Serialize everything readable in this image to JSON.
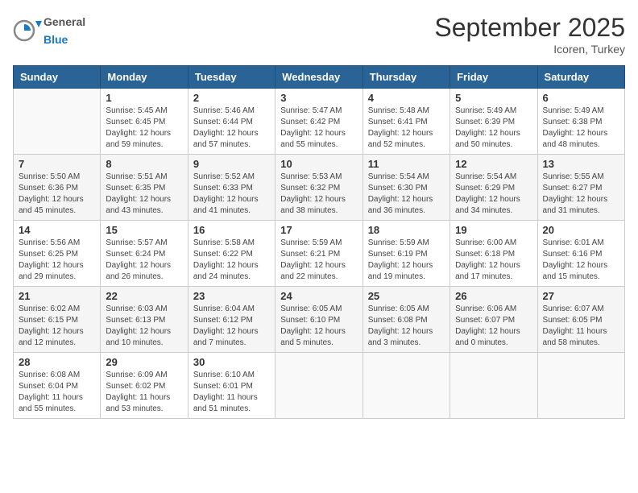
{
  "header": {
    "logo_general": "General",
    "logo_blue": "Blue",
    "month": "September 2025",
    "location": "Icoren, Turkey"
  },
  "days_of_week": [
    "Sunday",
    "Monday",
    "Tuesday",
    "Wednesday",
    "Thursday",
    "Friday",
    "Saturday"
  ],
  "weeks": [
    [
      {
        "day": "",
        "info": ""
      },
      {
        "day": "1",
        "info": "Sunrise: 5:45 AM\nSunset: 6:45 PM\nDaylight: 12 hours\nand 59 minutes."
      },
      {
        "day": "2",
        "info": "Sunrise: 5:46 AM\nSunset: 6:44 PM\nDaylight: 12 hours\nand 57 minutes."
      },
      {
        "day": "3",
        "info": "Sunrise: 5:47 AM\nSunset: 6:42 PM\nDaylight: 12 hours\nand 55 minutes."
      },
      {
        "day": "4",
        "info": "Sunrise: 5:48 AM\nSunset: 6:41 PM\nDaylight: 12 hours\nand 52 minutes."
      },
      {
        "day": "5",
        "info": "Sunrise: 5:49 AM\nSunset: 6:39 PM\nDaylight: 12 hours\nand 50 minutes."
      },
      {
        "day": "6",
        "info": "Sunrise: 5:49 AM\nSunset: 6:38 PM\nDaylight: 12 hours\nand 48 minutes."
      }
    ],
    [
      {
        "day": "7",
        "info": "Sunrise: 5:50 AM\nSunset: 6:36 PM\nDaylight: 12 hours\nand 45 minutes."
      },
      {
        "day": "8",
        "info": "Sunrise: 5:51 AM\nSunset: 6:35 PM\nDaylight: 12 hours\nand 43 minutes."
      },
      {
        "day": "9",
        "info": "Sunrise: 5:52 AM\nSunset: 6:33 PM\nDaylight: 12 hours\nand 41 minutes."
      },
      {
        "day": "10",
        "info": "Sunrise: 5:53 AM\nSunset: 6:32 PM\nDaylight: 12 hours\nand 38 minutes."
      },
      {
        "day": "11",
        "info": "Sunrise: 5:54 AM\nSunset: 6:30 PM\nDaylight: 12 hours\nand 36 minutes."
      },
      {
        "day": "12",
        "info": "Sunrise: 5:54 AM\nSunset: 6:29 PM\nDaylight: 12 hours\nand 34 minutes."
      },
      {
        "day": "13",
        "info": "Sunrise: 5:55 AM\nSunset: 6:27 PM\nDaylight: 12 hours\nand 31 minutes."
      }
    ],
    [
      {
        "day": "14",
        "info": "Sunrise: 5:56 AM\nSunset: 6:25 PM\nDaylight: 12 hours\nand 29 minutes."
      },
      {
        "day": "15",
        "info": "Sunrise: 5:57 AM\nSunset: 6:24 PM\nDaylight: 12 hours\nand 26 minutes."
      },
      {
        "day": "16",
        "info": "Sunrise: 5:58 AM\nSunset: 6:22 PM\nDaylight: 12 hours\nand 24 minutes."
      },
      {
        "day": "17",
        "info": "Sunrise: 5:59 AM\nSunset: 6:21 PM\nDaylight: 12 hours\nand 22 minutes."
      },
      {
        "day": "18",
        "info": "Sunrise: 5:59 AM\nSunset: 6:19 PM\nDaylight: 12 hours\nand 19 minutes."
      },
      {
        "day": "19",
        "info": "Sunrise: 6:00 AM\nSunset: 6:18 PM\nDaylight: 12 hours\nand 17 minutes."
      },
      {
        "day": "20",
        "info": "Sunrise: 6:01 AM\nSunset: 6:16 PM\nDaylight: 12 hours\nand 15 minutes."
      }
    ],
    [
      {
        "day": "21",
        "info": "Sunrise: 6:02 AM\nSunset: 6:15 PM\nDaylight: 12 hours\nand 12 minutes."
      },
      {
        "day": "22",
        "info": "Sunrise: 6:03 AM\nSunset: 6:13 PM\nDaylight: 12 hours\nand 10 minutes."
      },
      {
        "day": "23",
        "info": "Sunrise: 6:04 AM\nSunset: 6:12 PM\nDaylight: 12 hours\nand 7 minutes."
      },
      {
        "day": "24",
        "info": "Sunrise: 6:05 AM\nSunset: 6:10 PM\nDaylight: 12 hours\nand 5 minutes."
      },
      {
        "day": "25",
        "info": "Sunrise: 6:05 AM\nSunset: 6:08 PM\nDaylight: 12 hours\nand 3 minutes."
      },
      {
        "day": "26",
        "info": "Sunrise: 6:06 AM\nSunset: 6:07 PM\nDaylight: 12 hours\nand 0 minutes."
      },
      {
        "day": "27",
        "info": "Sunrise: 6:07 AM\nSunset: 6:05 PM\nDaylight: 11 hours\nand 58 minutes."
      }
    ],
    [
      {
        "day": "28",
        "info": "Sunrise: 6:08 AM\nSunset: 6:04 PM\nDaylight: 11 hours\nand 55 minutes."
      },
      {
        "day": "29",
        "info": "Sunrise: 6:09 AM\nSunset: 6:02 PM\nDaylight: 11 hours\nand 53 minutes."
      },
      {
        "day": "30",
        "info": "Sunrise: 6:10 AM\nSunset: 6:01 PM\nDaylight: 11 hours\nand 51 minutes."
      },
      {
        "day": "",
        "info": ""
      },
      {
        "day": "",
        "info": ""
      },
      {
        "day": "",
        "info": ""
      },
      {
        "day": "",
        "info": ""
      }
    ]
  ]
}
